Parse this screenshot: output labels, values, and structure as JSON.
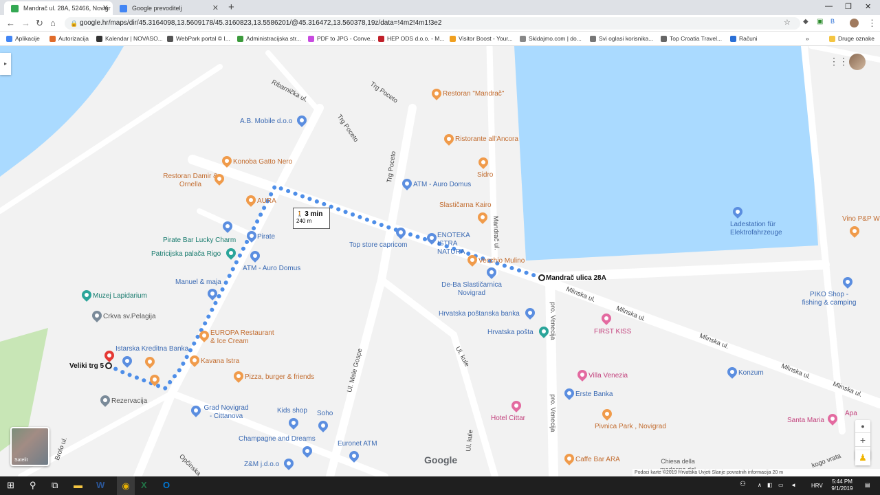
{
  "tabs": [
    {
      "title": "Mandrač ul. 28A, 52466, Novigr",
      "close": "✕",
      "color": "#34a853"
    },
    {
      "title": "Google prevoditelj",
      "close": "✕",
      "color": "#4285f4"
    }
  ],
  "new_tab": "+",
  "window_controls": {
    "minimize": "—",
    "maximize": "❐",
    "close": "✕"
  },
  "nav": {
    "back": "←",
    "forward": "→",
    "reload": "↻",
    "home": "⌂"
  },
  "url": "google.hr/maps/dir/45.3164098,13.5609178/45.3160823,13.5586201/@45.316472,13.560378,19z/data=!4m2!4m1!3e2",
  "bookmarks": [
    {
      "label": "Aplikacije",
      "color": "#4285f4"
    },
    {
      "label": "Autorizacija",
      "color": "#e06b2a"
    },
    {
      "label": "Kalendar | NOVASO...",
      "color": "#333333"
    },
    {
      "label": "WebPark portal © I...",
      "color": "#555555"
    },
    {
      "label": "Administracijska str...",
      "color": "#3c9a3c"
    },
    {
      "label": "PDF to JPG - Conve...",
      "color": "#c84be0"
    },
    {
      "label": "HEP ODS d.o.o. - M...",
      "color": "#c0202a"
    },
    {
      "label": "Visitor Boost - Your...",
      "color": "#f0a020"
    },
    {
      "label": "Skidajmo.com | do...",
      "color": "#888888"
    },
    {
      "label": "Svi oglasi korisnika...",
      "color": "#777777"
    },
    {
      "label": "Top Croatia Travel...",
      "color": "#666666"
    },
    {
      "label": "Računi",
      "color": "#2a6fd6"
    },
    {
      "label": "»",
      "color": "#ffffff"
    },
    {
      "label": "Druge oznake",
      "color": "#f4c542"
    }
  ],
  "map": {
    "route_time": "3 min",
    "route_distance": "240 m",
    "walk_icon": "🚶",
    "google_logo": "Google",
    "satellite_label": "Satelit",
    "footer": "Podaci karte ©2019    Hrvatska    Uvjeti    Slanje povratnih informacija    20 m",
    "zoom_in": "+",
    "zoom_out": "−",
    "sidebar_toggle": "▸",
    "places": [
      {
        "text": "Restoran \"Mandrač\"",
        "style": "orange"
      },
      {
        "text": "Ristorante all'Ancora",
        "style": "orange"
      },
      {
        "text": "A.B. Mobile d.o.o",
        "style": "blue"
      },
      {
        "text": "Konoba Gatto Nero",
        "style": "orange"
      },
      {
        "text": "Restoran Damir & Ornella",
        "style": "orange"
      },
      {
        "text": "AURA",
        "style": "orange"
      },
      {
        "text": "ATM - Auro Domus",
        "style": "blue"
      },
      {
        "text": "Sidro",
        "style": "orange"
      },
      {
        "text": "Slastičarna Kairo",
        "style": "orange"
      },
      {
        "text": "Pirate Bar Lucky Charm",
        "style": "teal"
      },
      {
        "text": "Pirate",
        "style": "blue"
      },
      {
        "text": "Top store capricom",
        "style": "blue"
      },
      {
        "text": "ENOTEKA ISTRA NATURA",
        "style": "blue"
      },
      {
        "text": "Patricijska palača Rigo",
        "style": "teal"
      },
      {
        "text": "ATM - Auro Domus",
        "style": "blue"
      },
      {
        "text": "Vecchio Mulino",
        "style": "orange"
      },
      {
        "text": "Mandrač ulica 28A",
        "style": "black"
      },
      {
        "text": "Manuel & maja",
        "style": "blue"
      },
      {
        "text": "De-Ba Slastičarnica Novigrad",
        "style": "blue"
      },
      {
        "text": "Muzej Lapidarium",
        "style": "teal"
      },
      {
        "text": "Crkva sv.Pelagija",
        "style": "grey"
      },
      {
        "text": "Hrvatska poštanska banka",
        "style": "blue"
      },
      {
        "text": "Hrvatska pošta",
        "style": "blue"
      },
      {
        "text": "FIRST KISS",
        "style": "pink"
      },
      {
        "text": "EUROPA Restaurant & Ice Cream",
        "style": "orange"
      },
      {
        "text": "Istarska Kreditna Banka",
        "style": "blue"
      },
      {
        "text": "Kavana Istra",
        "style": "orange"
      },
      {
        "text": "Veliki trg 5",
        "style": "black"
      },
      {
        "text": "Pizza, burger & friends",
        "style": "orange"
      },
      {
        "text": "Rezervacija",
        "style": "grey"
      },
      {
        "text": "Villa Venezia",
        "style": "pink"
      },
      {
        "text": "Erste Banka",
        "style": "blue"
      },
      {
        "text": "Konzum",
        "style": "blue"
      },
      {
        "text": "Grad Novigrad - Cittanova",
        "style": "blue"
      },
      {
        "text": "Kids shop",
        "style": "blue"
      },
      {
        "text": "Soho",
        "style": "blue"
      },
      {
        "text": "Hotel Cittar",
        "style": "pink"
      },
      {
        "text": "Pivnica Park , Novigrad",
        "style": "orange"
      },
      {
        "text": "Champagne and Dreams",
        "style": "blue"
      },
      {
        "text": "Euronet ATM",
        "style": "blue"
      },
      {
        "text": "Caffe Bar ARA",
        "style": "orange"
      },
      {
        "text": "Z&M j.d.o.o",
        "style": "blue"
      },
      {
        "text": "Chiesa della madonna del porto",
        "style": "grey"
      },
      {
        "text": "Ladestation für Elektrofahrzeuge",
        "style": "blue"
      },
      {
        "text": "Vino P&P W",
        "style": "orange"
      },
      {
        "text": "PIKO Shop - fishing & camping",
        "style": "blue"
      },
      {
        "text": "Santa Maria",
        "style": "pink"
      },
      {
        "text": "Apa",
        "style": "pink"
      }
    ],
    "roads": [
      "Ribarnička ul.",
      "Trg Poceto",
      "Trg Poceto",
      "Trg Poceto",
      "Mandrač ul.",
      "Mlinska ul.",
      "Mlinska ul.",
      "Mlinska ul.",
      "Mlinska ul.",
      "Mlinska ul.",
      "pro. Venecija",
      "pro. Venecija",
      "Ul. kule",
      "Ul. kule",
      "Ul. Male Gospe",
      "Opčinska",
      "Brolo ul.",
      "kogo vrata"
    ]
  },
  "taskbar": {
    "start": "⊞",
    "search": "⚲",
    "time": "5:44 PM",
    "date": "9/1/2019",
    "lang": "HRV"
  }
}
